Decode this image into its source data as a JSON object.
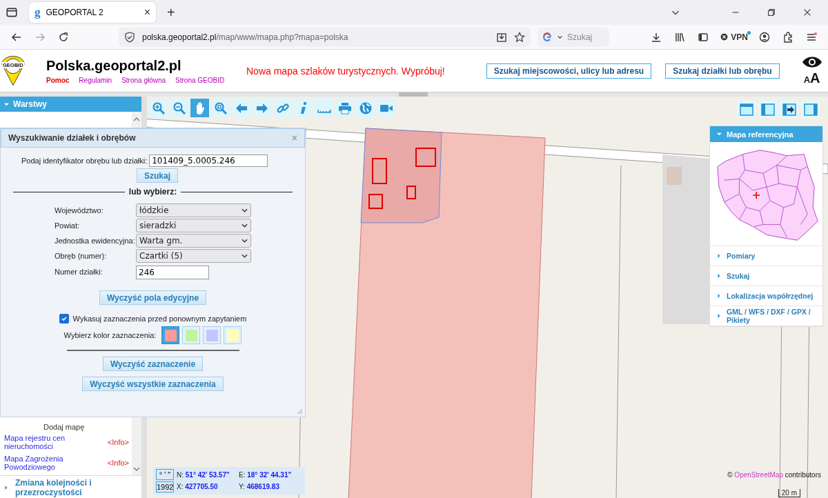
{
  "browser": {
    "tab": {
      "favicon": "g",
      "title": "GEOPORTAL 2",
      "close": "×"
    },
    "new_tab": "+",
    "url": {
      "host": "polska.geoportal2.pl",
      "path": "/map/www/mapa.php?mapa=polska"
    },
    "search": {
      "placeholder": "Szukaj"
    },
    "vpn": "VPN"
  },
  "header": {
    "logo_text": "GEOBID",
    "title": "Polska.geoportal2.pl",
    "links": [
      {
        "label": "Pomoc",
        "kind": "help"
      },
      {
        "label": "Regulamin",
        "kind": "link"
      },
      {
        "label": "Strona główna",
        "kind": "link"
      },
      {
        "label": "Strona GEOBID",
        "kind": "link"
      }
    ],
    "promo": "Nowa mapa szlaków turystycznych. Wypróbuj!",
    "buttons": [
      "Szukaj miejscowości, ulicy lub adresu",
      "Szukaj działki lub obrębu"
    ],
    "font_size": {
      "small": "A",
      "large": "A"
    }
  },
  "sidebar": {
    "title": "Warstwy",
    "expanded": true,
    "partial_item": "Dodaj mapę",
    "items": [
      {
        "label": "Mapa rejestru cen nieruchomości",
        "info": "<Info>"
      },
      {
        "label": "Mapa Zagrożenia Powodziowego",
        "info": "<Info>"
      }
    ],
    "bottom_item": {
      "label": "Zmiana kolejności i przezroczystości",
      "expanded": false
    }
  },
  "toolbar": [
    {
      "kind": "zoom-in",
      "selected": false
    },
    {
      "kind": "zoom-out",
      "selected": false
    },
    {
      "kind": "pan",
      "selected": true
    },
    {
      "kind": "zoom-extent",
      "selected": false
    },
    {
      "kind": "back",
      "selected": false
    },
    {
      "kind": "forward",
      "selected": false
    },
    {
      "kind": "link",
      "selected": false
    },
    {
      "kind": "info",
      "selected": false
    },
    {
      "kind": "measure",
      "selected": false
    },
    {
      "kind": "print",
      "selected": false
    },
    {
      "kind": "globe",
      "selected": false
    },
    {
      "kind": "video",
      "selected": false
    }
  ],
  "view_buttons": [
    {
      "kind": "top"
    },
    {
      "kind": "left"
    },
    {
      "kind": "export"
    },
    {
      "kind": "right"
    }
  ],
  "dialog": {
    "title": "Wyszukiwanie działek i obrębów",
    "close": "×",
    "id_field": {
      "label": "Podaj identyfikator obrębu lub działki:",
      "value": "101409_5.0005.246"
    },
    "search_button": "Szukaj",
    "divider": "lub wybierz:",
    "selects": [
      {
        "label": "Województwo:",
        "value": "łódzkie"
      },
      {
        "label": "Powiat:",
        "value": "sieradzki"
      },
      {
        "label": "Jednostka ewidencyjna:",
        "value": "Warta gm."
      },
      {
        "label": "Obręb (numer):",
        "value": "Czartki (5)"
      }
    ],
    "number_field": {
      "label": "Numer działki:",
      "value": "246"
    },
    "clear_fields_button": "Wyczyść pola edycyjne",
    "checkbox": {
      "label": "Wykasuj zaznaczenia przed ponownym zapytaniem",
      "checked": true
    },
    "color_label": "Wybierz kolor zaznaczenia:",
    "swatches": [
      {
        "color": "#ff9999",
        "selected": true
      },
      {
        "color": "#bff5a0",
        "selected": false
      },
      {
        "color": "#c4c4ff",
        "selected": false
      },
      {
        "color": "#ffffbb",
        "selected": false
      }
    ],
    "buttons": [
      "Wyczyść zaznaczenie",
      "Wyczyść wszystkie zaznaczenia"
    ]
  },
  "reference_panel": {
    "title": "Mapa referencyjna",
    "expanded": true,
    "items": [
      {
        "label": "Pomiary",
        "expanded": false
      },
      {
        "label": "Szukaj",
        "expanded": false
      },
      {
        "label": "Lokalizacja współrzędnej",
        "expanded": false
      },
      {
        "label": "GML / WFS / DXF / GPX / Pikiety",
        "expanded": false
      }
    ]
  },
  "coordinates": {
    "format_button": "° ' \"",
    "system_button": "1992",
    "rows": [
      [
        {
          "label": "N:",
          "value": "51° 42' 53.57\""
        },
        {
          "label": "E:",
          "value": "18° 32' 44.31\""
        }
      ],
      [
        {
          "label": "X:",
          "value": "427705.50"
        },
        {
          "label": "Y:",
          "value": "468619.83"
        }
      ]
    ]
  },
  "attribution": {
    "prefix": "©",
    "link": "OpenStreetMap",
    "suffix": "contributors"
  },
  "scale": "20 m"
}
